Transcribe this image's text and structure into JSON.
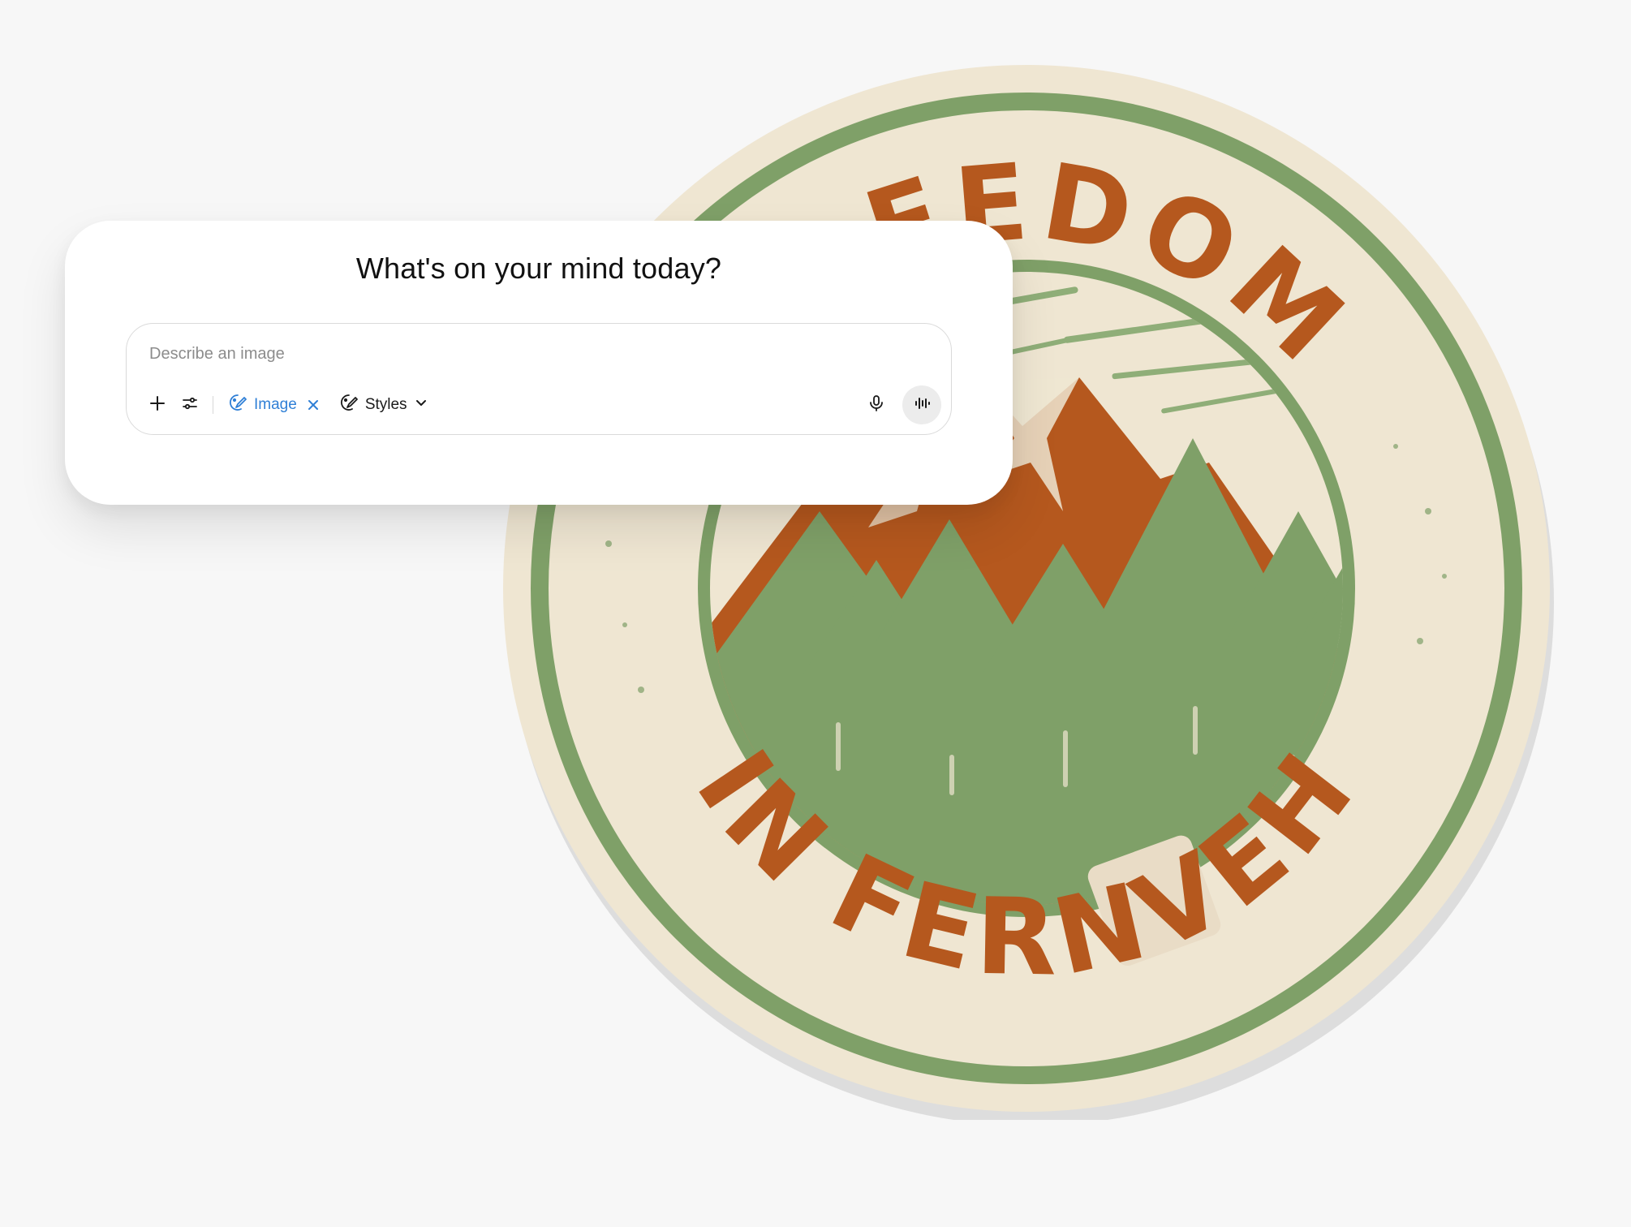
{
  "prompt_card": {
    "title": "What's on your mind today?",
    "input_placeholder": "Describe an image",
    "add_icon": "plus-icon",
    "tools_icon": "sliders-icon",
    "image_chip": {
      "label": "Image",
      "icon": "image-brush-icon",
      "remove_icon": "close-icon",
      "color": "#2f7fd6"
    },
    "styles_chip": {
      "label": "Styles",
      "icon": "palette-icon",
      "dropdown_icon": "chevron-down-icon"
    },
    "mic_icon": "microphone-icon",
    "voice_icon": "voice-waveform-icon"
  },
  "badge": {
    "top_text": "FREEDOM",
    "bottom_text": "IN FERNVEH",
    "colors": {
      "cream": "#efe6d2",
      "green": "#7fa068",
      "rust": "#b5581e",
      "highlight": "#e9dcc6"
    }
  }
}
